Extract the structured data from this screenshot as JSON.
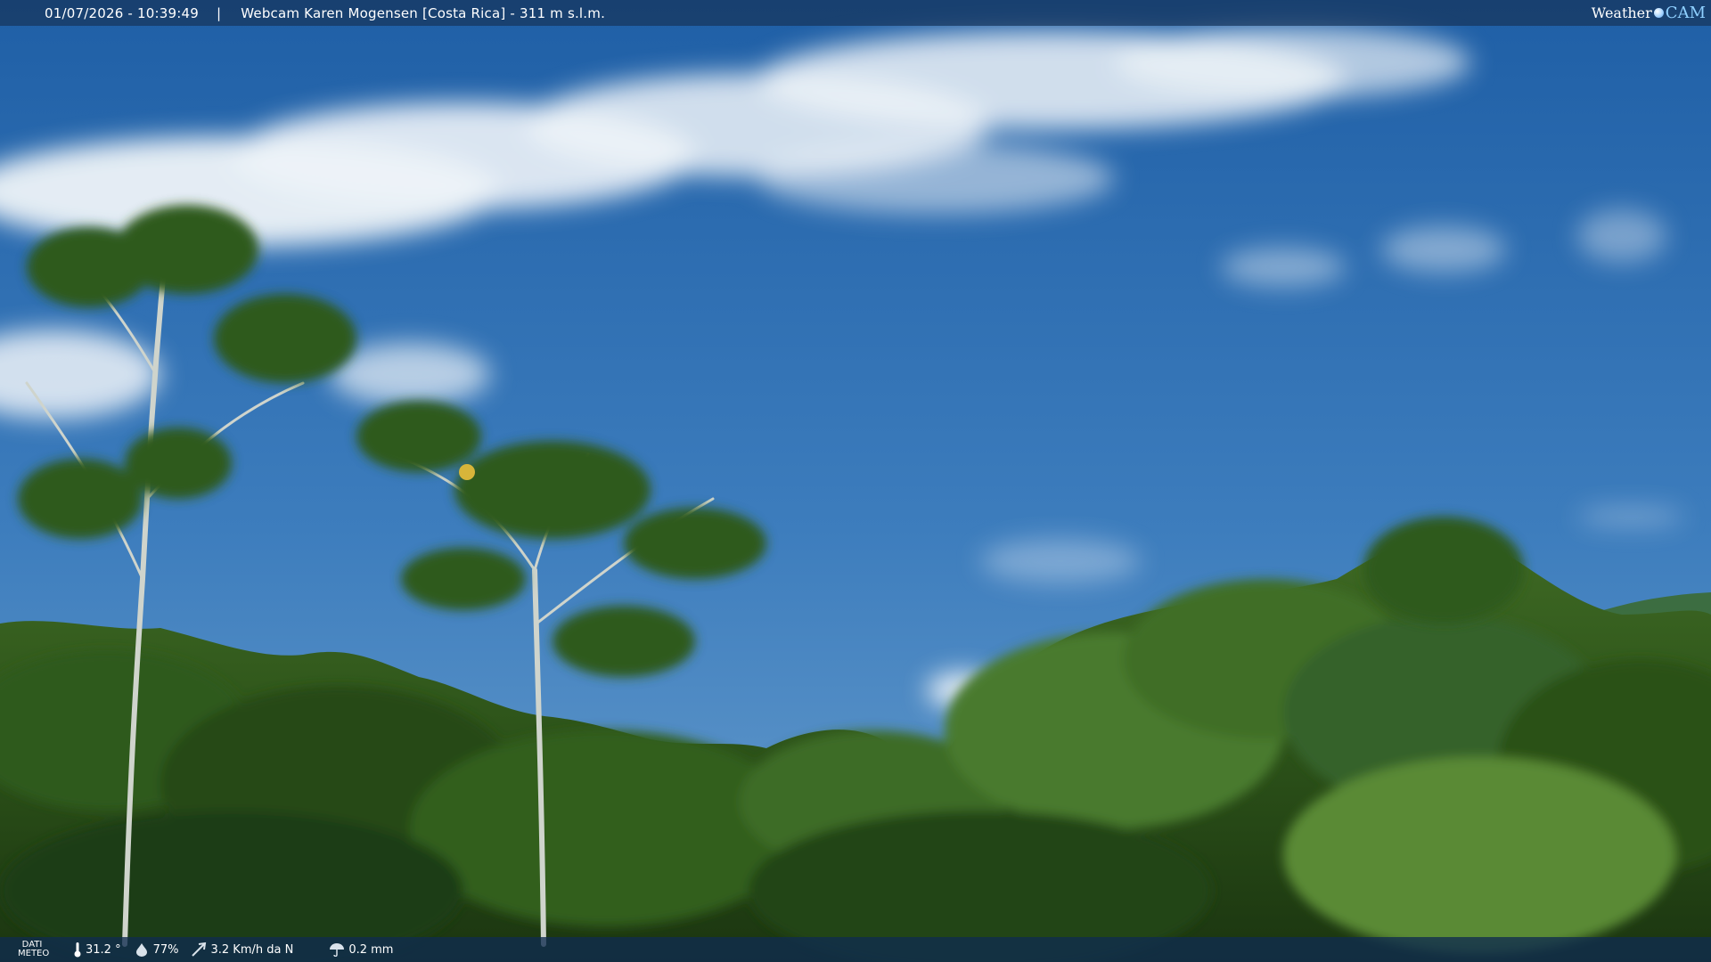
{
  "header": {
    "datetime": "01/07/2026 - 10:39:49",
    "separator": "|",
    "title": "Webcam Karen Mogensen [Costa Rica] - 311 m s.l.m.",
    "logo_text_1": "Weather",
    "logo_text_2": "CAM"
  },
  "footer": {
    "label_line1": "DATI",
    "label_line2": "METEO",
    "temperature": "31.2 °",
    "humidity": "77%",
    "wind": "3.2 Km/h da N",
    "rain": "0.2 mm"
  },
  "colors": {
    "sky_top": "#1f5fa6",
    "sky_bottom": "#5f95c6",
    "foliage_dark": "#1f3f16",
    "foliage_light": "#4f7a2c"
  }
}
